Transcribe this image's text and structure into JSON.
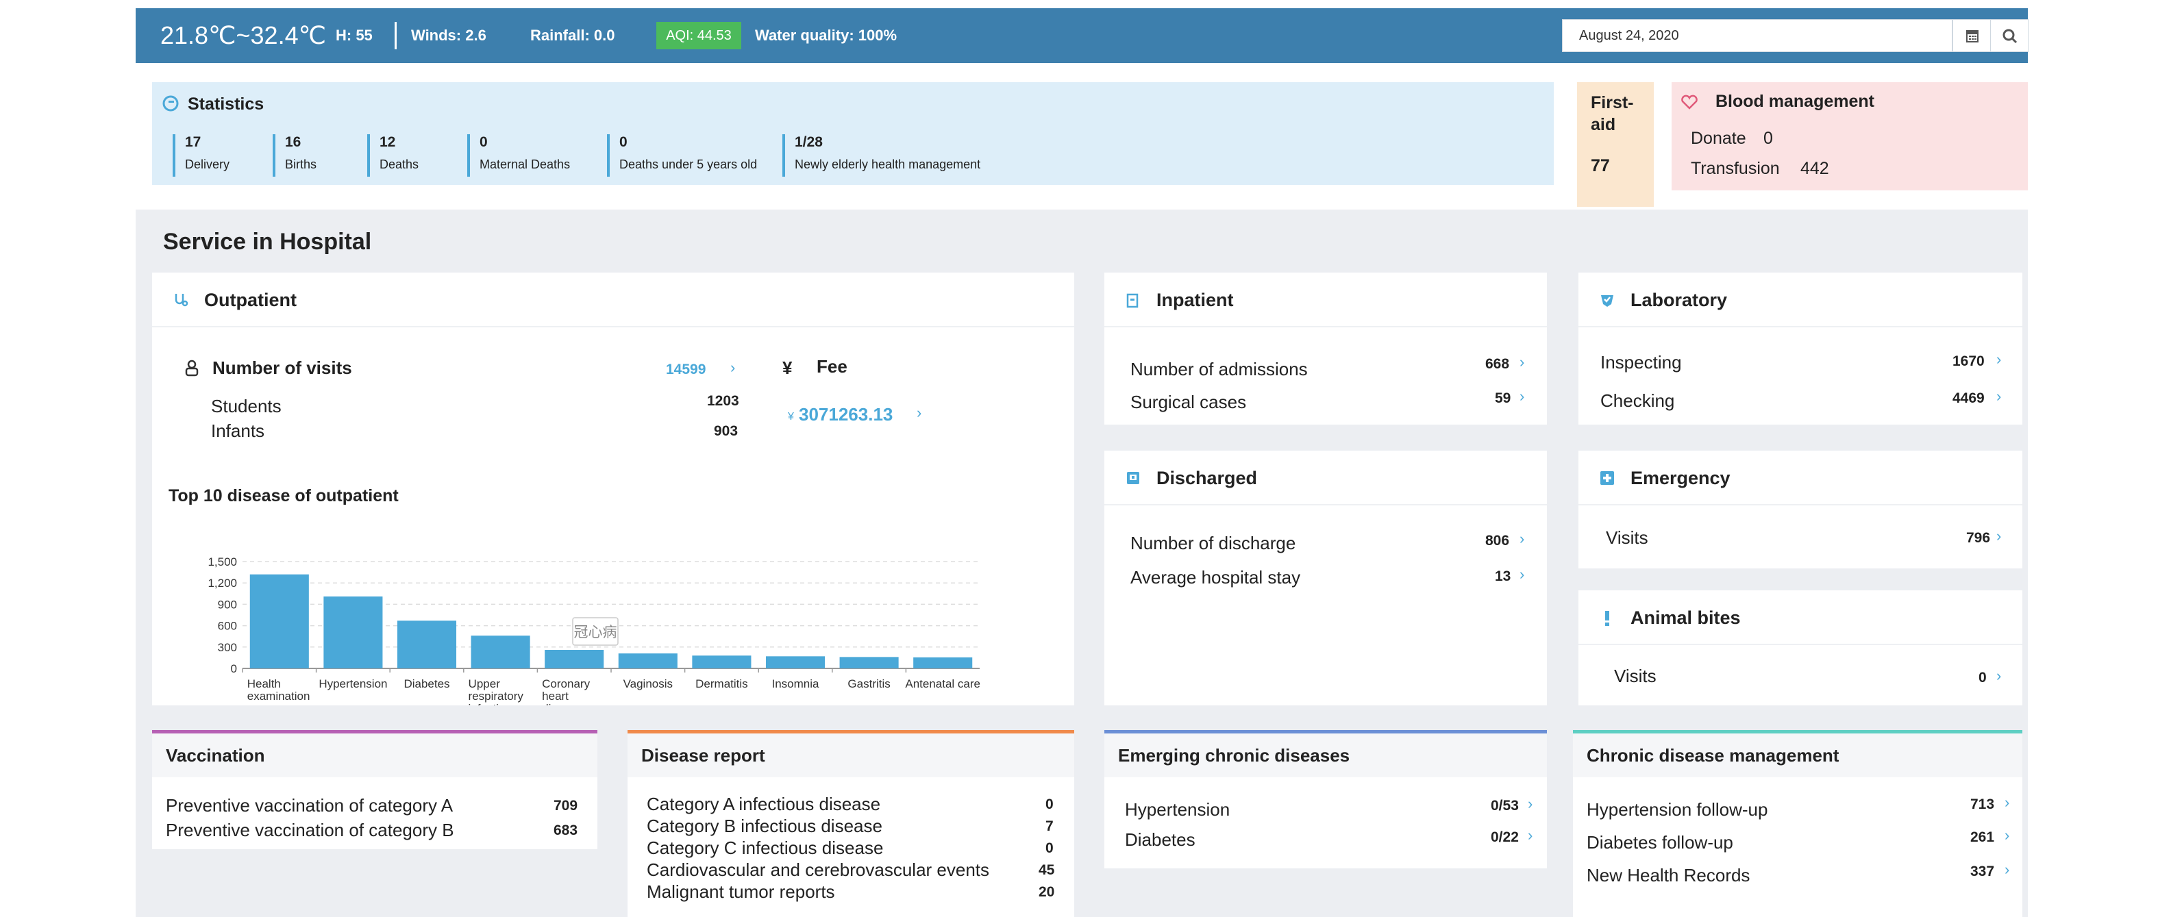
{
  "weather": {
    "temperature": "21.8℃~32.4℃",
    "humidity": "H: 55",
    "winds": "Winds: 2.6",
    "rainfall": "Rainfall: 0.0",
    "aqi": "AQI:  44.53",
    "water_quality": "Water quality: 100%",
    "aqi_color": "#4cba5b"
  },
  "date_picker": {
    "value": "August 24, 2020",
    "calendar_icon": "calendar-icon",
    "search_icon": "search-icon"
  },
  "statistics": {
    "title": "Statistics",
    "items": [
      {
        "value": "17",
        "label": "Delivery"
      },
      {
        "value": "16",
        "label": "Births"
      },
      {
        "value": "12",
        "label": "Deaths"
      },
      {
        "value": "0",
        "label": "Maternal Deaths"
      },
      {
        "value": "0",
        "label": "Deaths under 5 years old"
      },
      {
        "value": "1/28",
        "label": "Newly elderly health management"
      }
    ]
  },
  "first_aid": {
    "title": "First-aid",
    "value": "77"
  },
  "blood": {
    "title": "Blood management",
    "donate_label": "Donate",
    "donate_value": "0",
    "transfusion_label": "Transfusion",
    "transfusion_value": "442"
  },
  "service": {
    "title": "Service in Hospital"
  },
  "outpatient": {
    "title": "Outpatient",
    "visits_label": "Number of visits",
    "visits_value": "14599",
    "students_label": "Students",
    "students_value": "1203",
    "infants_label": "Infants",
    "infants_value": "903",
    "fee_label": "Fee",
    "fee_currency": "¥",
    "fee_value": "3071263.13",
    "chart_title": "Top 10 disease of outpatient",
    "tooltip": "冠心病"
  },
  "chart_data": {
    "type": "bar",
    "title": "Top 10 disease of outpatient",
    "categories": [
      "Health examination",
      "Hypertension",
      "Diabetes",
      "Upper respiratory infection",
      "Coronary heart disease",
      "Vaginosis",
      "Dermatitis",
      "Insomnia",
      "Gastritis",
      "Antenatal care"
    ],
    "category_lines": [
      [
        "Health",
        "examination"
      ],
      [
        "Hypertension"
      ],
      [
        "Diabetes"
      ],
      [
        "Upper",
        "respiratory",
        "infection"
      ],
      [
        "Coronary",
        "heart",
        "disease"
      ],
      [
        "Vaginosis"
      ],
      [
        "Dermatitis"
      ],
      [
        "Insomnia"
      ],
      [
        "Gastritis"
      ],
      [
        "Antenatal care"
      ]
    ],
    "values": [
      1320,
      1010,
      670,
      460,
      260,
      210,
      180,
      170,
      160,
      155
    ],
    "yticks": [
      "0",
      "300",
      "600",
      "900",
      "1,200",
      "1,500"
    ],
    "ylim": [
      0,
      1500
    ],
    "bar_color": "#4aa8d8",
    "grid": true
  },
  "inpatient": {
    "title": "Inpatient",
    "rows": [
      {
        "label": "Number of admissions",
        "value": "668"
      },
      {
        "label": "Surgical cases",
        "value": "59"
      }
    ]
  },
  "discharged": {
    "title": "Discharged",
    "rows": [
      {
        "label": "Number of discharge",
        "value": "806"
      },
      {
        "label": "Average hospital stay",
        "value": "13"
      }
    ]
  },
  "laboratory": {
    "title": "Laboratory",
    "rows": [
      {
        "label": "Inspecting",
        "value": "1670"
      },
      {
        "label": "Checking",
        "value": "4469"
      }
    ]
  },
  "emergency": {
    "title": "Emergency",
    "rows": [
      {
        "label": "Visits",
        "value": "796"
      }
    ]
  },
  "animal_bites": {
    "title": "Animal bites",
    "rows": [
      {
        "label": "Visits",
        "value": "0"
      }
    ]
  },
  "vaccination": {
    "title": "Vaccination",
    "accent": "#b660b4",
    "rows": [
      {
        "label": "Preventive vaccination of category A",
        "value": "709"
      },
      {
        "label": "Preventive vaccination of category B",
        "value": "683"
      }
    ]
  },
  "disease_report": {
    "title": "Disease report",
    "accent": "#f08a4b",
    "rows": [
      {
        "label": "Category A infectious disease",
        "value": "0"
      },
      {
        "label": "Category B infectious disease",
        "value": "7"
      },
      {
        "label": "Category C infectious disease",
        "value": "0"
      },
      {
        "label": "Cardiovascular and cerebrovascular events",
        "value": "45"
      },
      {
        "label": "Malignant tumor reports",
        "value": "20"
      }
    ]
  },
  "emerging_chronic": {
    "title": "Emerging chronic diseases",
    "accent": "#6b8fd6",
    "rows": [
      {
        "label": "Hypertension",
        "value": "0/53"
      },
      {
        "label": "Diabetes",
        "value": "0/22"
      }
    ]
  },
  "chronic_management": {
    "title": "Chronic disease management",
    "accent": "#5ecfc3",
    "rows": [
      {
        "label": "Hypertension follow-up",
        "value": "713"
      },
      {
        "label": "Diabetes follow-up",
        "value": "261"
      },
      {
        "label": "New Health Records",
        "value": "337"
      }
    ]
  }
}
